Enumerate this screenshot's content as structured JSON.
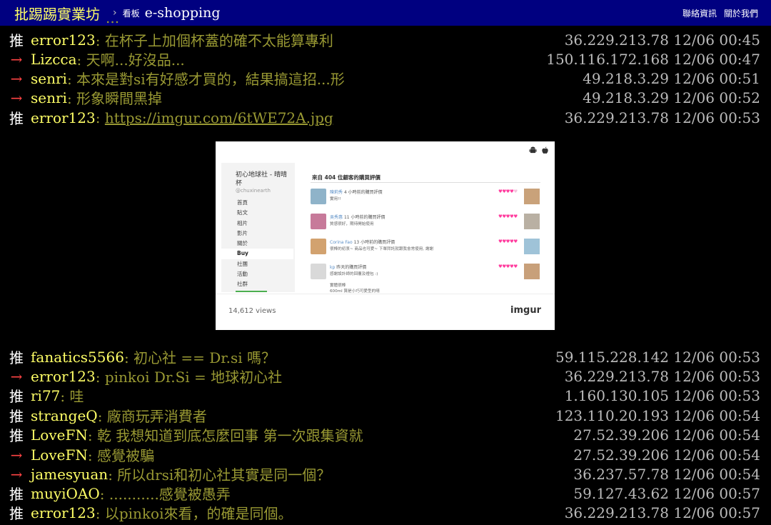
{
  "header": {
    "site_name": "批踢踢實業坊",
    "separator": "›",
    "board_label": "看板",
    "board_name": "e-shopping",
    "nav": [
      "聯絡資訊",
      "關於我們"
    ]
  },
  "cut_off_text": "...",
  "pushes_before": [
    {
      "tag": "推",
      "type": "push",
      "user": "error123",
      "content": ": 在杯子上加個杯蓋的確不太能算專利",
      "ipdatetime": "36.229.213.78 12/06 00:45"
    },
    {
      "tag": "→",
      "type": "arrow",
      "user": "Lizcca",
      "content": ": 天啊...好沒品...",
      "ipdatetime": "150.116.172.168 12/06 00:47"
    },
    {
      "tag": "→",
      "type": "arrow",
      "user": "senri",
      "content": ": 本來是對si有好感才買的，結果搞這招...形",
      "ipdatetime": "49.218.3.29 12/06 00:51"
    },
    {
      "tag": "→",
      "type": "arrow",
      "user": "senri",
      "content": ": 形象瞬間黑掉",
      "ipdatetime": "49.218.3.29 12/06 00:52"
    },
    {
      "tag": "推",
      "type": "push",
      "user": "error123",
      "content_prefix": ": ",
      "link": "https://imgur.com/6tWE72A.jpg",
      "ipdatetime": "36.229.213.78 12/06 00:53"
    }
  ],
  "embed": {
    "shop_name": "初心地球社 - 晴晴杯",
    "handle": "@chuxinearth",
    "nav_items": [
      "首頁",
      "貼文",
      "相片",
      "影片",
      "關於",
      "Buy",
      "社團",
      "活動",
      "社群"
    ],
    "active_nav": "Buy",
    "reviews_heading": "來自 404 位顧客的購買評價",
    "reviews": [
      {
        "name": "陳莉秀",
        "time": "4 小時前的購買評價",
        "text": "實用!!",
        "stars": 4,
        "avatar_color": "#8fb3c9",
        "thumb_color": "#c9a27a"
      },
      {
        "name": "吳秀惠",
        "time": "11 小時前的購買評價",
        "text": "質感很好，期待開始使用",
        "stars": 5,
        "avatar_color": "#c77a9a",
        "thumb_color": "#b9b0a3"
      },
      {
        "name": "Corina Fao",
        "time": "13 小時前的購買評價",
        "text": "很棒的初衷~ 商品也可愛~ 下單拜託就跟我會常使用, 謝謝",
        "stars": 5,
        "avatar_color": "#d2a26f",
        "thumb_color": "#9fc3d8"
      },
      {
        "name": "kp",
        "time": "昨天的購買評價",
        "text": "感謝設計師的回覆及禮包 :)",
        "text2": "實體很棒",
        "text3": "600ml 算是小巧可愛型的唷",
        "stars": 5,
        "avatar_color": "#d9d9d9",
        "thumb_color": "#c8a07a"
      }
    ],
    "views": "14,612 views",
    "logo": "imgur"
  },
  "pushes_after": [
    {
      "tag": "推",
      "type": "push",
      "user": "fanatics5566",
      "content": ": 初心社 == Dr.si 嗎？",
      "ipdatetime": "59.115.228.142 12/06 00:53"
    },
    {
      "tag": "→",
      "type": "arrow",
      "user": "error123",
      "content": ": pinkoi Dr.Si = 地球初心社",
      "ipdatetime": "36.229.213.78 12/06 00:53"
    },
    {
      "tag": "推",
      "type": "push",
      "user": "ri77",
      "content": ": 哇",
      "ipdatetime": "1.160.130.105 12/06 00:53"
    },
    {
      "tag": "推",
      "type": "push",
      "user": "strangeQ",
      "content": ": 廠商玩弄消費者",
      "ipdatetime": "123.110.20.193 12/06 00:54"
    },
    {
      "tag": "推",
      "type": "push",
      "user": "LoveFN",
      "content": ": 乾 我想知道到底怎麼回事 第一次跟集資就",
      "ipdatetime": "27.52.39.206 12/06 00:54"
    },
    {
      "tag": "→",
      "type": "arrow",
      "user": "LoveFN",
      "content": ": 感覺被騙",
      "ipdatetime": "27.52.39.206 12/06 00:54"
    },
    {
      "tag": "→",
      "type": "arrow",
      "user": "jamesyuan",
      "content": ": 所以drsi和初心社其實是同一個？",
      "ipdatetime": "36.237.57.78 12/06 00:54"
    },
    {
      "tag": "推",
      "type": "push",
      "user": "muyiOAO",
      "content": ": ...........感覺被愚弄",
      "ipdatetime": "59.127.43.62 12/06 00:57"
    },
    {
      "tag": "推",
      "type": "push",
      "user": "error123",
      "content": ": 以pinkoi來看，的確是同個。",
      "ipdatetime": "36.229.213.78 12/06 00:57"
    }
  ]
}
